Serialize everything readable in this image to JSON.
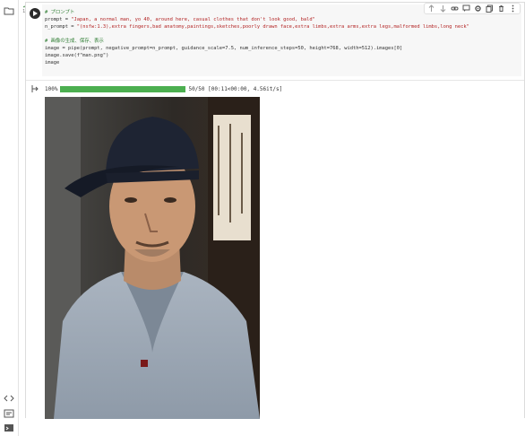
{
  "cell": {
    "meta_top": "1s",
    "meta_bottom": "✓"
  },
  "code": {
    "line1": "# プロンプト",
    "line2a": "prompt = ",
    "line2b": "\"Japan, a normal man, yo 40, around here, casual clothes that don't look good, bald\"",
    "line3a": "n_prompt = ",
    "line3b": "\"(nsfw:1.3),extra fingers,bad anatomy,paintings,sketches,poorly drawn face,extra limbs,extra arms,extra legs,malformed limbs,long neck\"",
    "line4": "# 画像の生成、保存、表示",
    "line5": "image = pipe(prompt, negative_prompt=n_prompt, guidance_scale=7.5, num_inference_steps=50, height=768, width=512).images[0]",
    "line6": "image.save(f\"man.png\")",
    "line7": "image"
  },
  "output": {
    "progress_percent": "100%",
    "progress_fraction": 1.0,
    "progress_status": "50/50 [00:11<00:00, 4.56it/s]"
  },
  "colors": {
    "progress_fill": "#4caf50",
    "comment": "#2e7d32",
    "string": "#b32424"
  },
  "icons": {
    "rail": [
      "folder-icon",
      "code-icon",
      "terminal-icon",
      "console-icon"
    ],
    "toolbar": [
      "arrow-up-icon",
      "arrow-down-icon",
      "link-icon",
      "comment-icon",
      "settings-icon",
      "copy-icon",
      "delete-icon",
      "more-icon"
    ],
    "output": "output-icon"
  }
}
